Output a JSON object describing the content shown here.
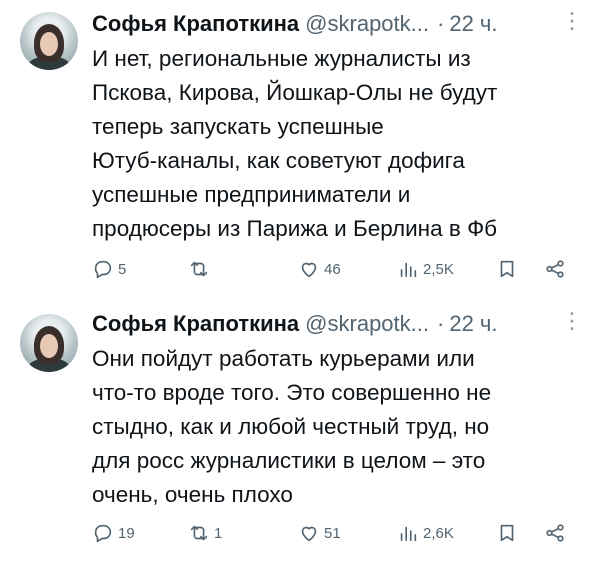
{
  "tweets": [
    {
      "author": "Софья Крапоткина",
      "handle": "@skrapotk...",
      "separator": "·",
      "time": "22 ч.",
      "text": "И нет, региональные журналисты из\nПскова, Кирова, Йошкар-Олы не будут\nтеперь запускать успешные\nЮтуб-каналы, как советуют дофига\nуспешные предприниматели и\nпродюсеры из Парижа и Берлина в Фб",
      "replies": "5",
      "retweets": "",
      "likes": "46",
      "views": "2,5K",
      "icons": [
        "reply-icon",
        "retweet-icon",
        "like-icon",
        "views-icon",
        "bookmark-icon",
        "share-icon"
      ]
    },
    {
      "author": "Софья Крапоткина",
      "handle": "@skrapotk...",
      "separator": "·",
      "time": "22 ч.",
      "text": "Они пойдут работать курьерами или\nчто-то вроде того. Это совершенно не\nстыдно, как и любой честный труд, но\nдля росс журналистики в целом – это\nочень, очень плохо",
      "replies": "19",
      "retweets": "1",
      "likes": "51",
      "views": "2,6K",
      "icons": [
        "reply-icon",
        "retweet-icon",
        "like-icon",
        "views-icon",
        "bookmark-icon",
        "share-icon"
      ]
    }
  ],
  "colors": {
    "text": "#0f1419",
    "secondary": "#536471",
    "background": "#ffffff"
  }
}
